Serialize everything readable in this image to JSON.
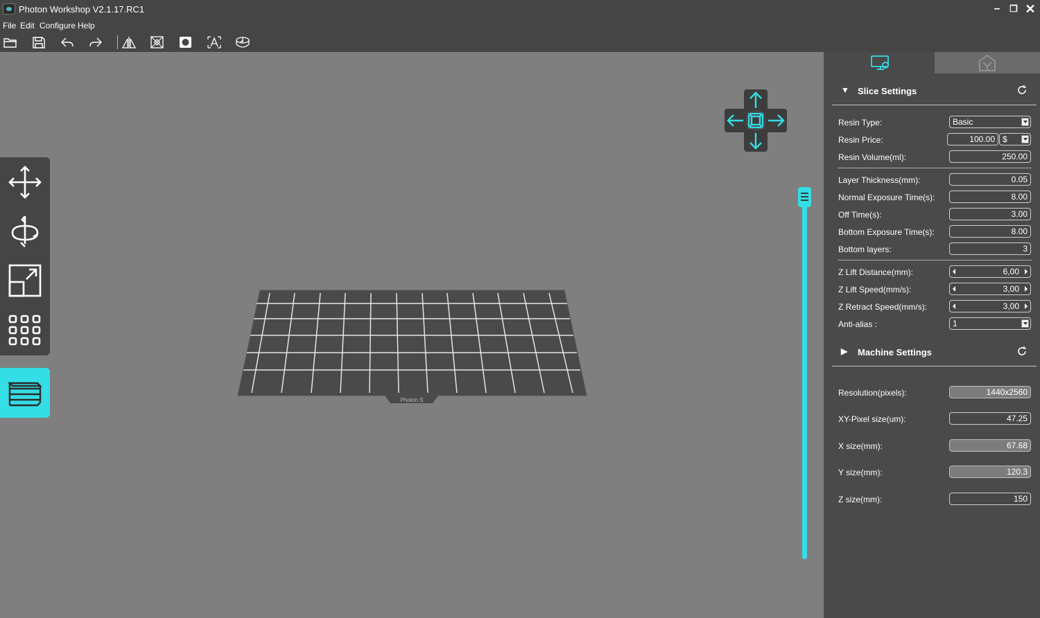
{
  "window": {
    "title": "Photon Workshop V2.1.17.RC1",
    "controls": [
      "minimize",
      "restore",
      "close"
    ]
  },
  "menu": [
    "File",
    "Edit",
    "Configure",
    "Help"
  ],
  "toolbar": {
    "icons": [
      "open-folder-icon",
      "save-icon",
      "undo-icon",
      "redo-icon",
      "mirror-icon",
      "hollow-icon",
      "punch-hole-icon",
      "text-icon",
      "slice-icon"
    ]
  },
  "left_tools": [
    "move-icon",
    "rotate-icon",
    "scale-icon",
    "arrange-icon",
    "layers-icon"
  ],
  "platform": {
    "label": "Photon S"
  },
  "accent_color": "#35dde5",
  "panel": {
    "tabs": [
      "slice-settings-tab",
      "machine-tab"
    ],
    "slice_settings": {
      "title": "Slice Settings",
      "resin_type": {
        "label": "Resin Type:",
        "value": "Basic"
      },
      "resin_price": {
        "label": "Resin Price:",
        "value": "100.00",
        "currency": "$"
      },
      "resin_volume": {
        "label": "Resin Volume(ml):",
        "value": "250.00"
      },
      "layer_thickness": {
        "label": "Layer Thickness(mm):",
        "value": "0.05"
      },
      "normal_exposure": {
        "label": "Normal Exposure Time(s):",
        "value": "8.00"
      },
      "off_time": {
        "label": "Off Time(s):",
        "value": "3.00"
      },
      "bottom_exposure": {
        "label": "Bottom Exposure Time(s):",
        "value": "8.00"
      },
      "bottom_layers": {
        "label": "Bottom layers:",
        "value": "3"
      },
      "z_lift_distance": {
        "label": "Z Lift Distance(mm):",
        "value": "6,00"
      },
      "z_lift_speed": {
        "label": "Z Lift Speed(mm/s):",
        "value": "3,00"
      },
      "z_retract_speed": {
        "label": "Z Retract Speed(mm/s):",
        "value": "3,00"
      },
      "anti_alias": {
        "label": "Anti-alias :",
        "value": "1"
      }
    },
    "machine_settings": {
      "title": "Machine Settings",
      "resolution": {
        "label": "Resolution(pixels):",
        "value": "1440x2560"
      },
      "xy_pixel_size": {
        "label": "XY-Pixel size(um):",
        "value": "47.25"
      },
      "x_size": {
        "label": "X size(mm):",
        "value": "67.68"
      },
      "y_size": {
        "label": "Y size(mm):",
        "value": "120.3"
      },
      "z_size": {
        "label": "Z size(mm):",
        "value": "150"
      }
    }
  }
}
